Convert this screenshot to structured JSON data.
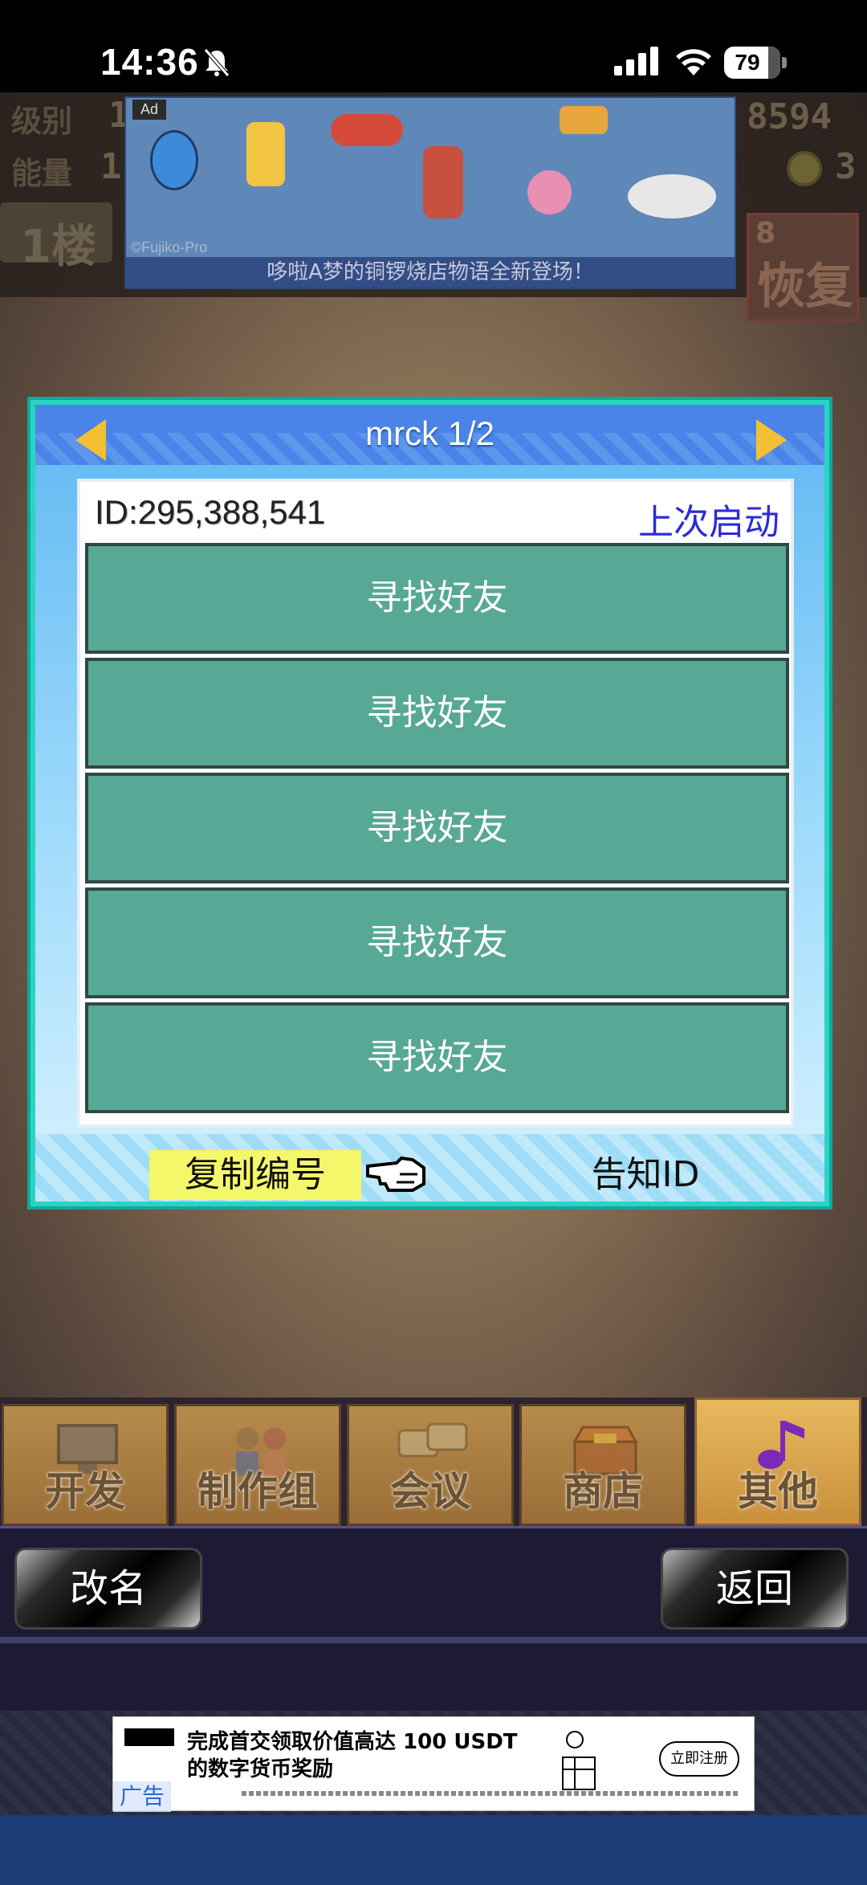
{
  "status_bar": {
    "time": "14:36",
    "battery": "79"
  },
  "hud": {
    "level_label": "级别",
    "level_value": "1",
    "energy_label": "能量",
    "energy_value": "1",
    "floor": "1楼",
    "money": "8594",
    "coins": "3",
    "recover_count": "8",
    "recover_label": "恢复"
  },
  "ad_top": {
    "badge": "Ad",
    "copyright": "©Fujiko-Pro",
    "caption": "哆啦A梦的铜锣烧店物语全新登场！"
  },
  "panel": {
    "title": "mrck 1/2",
    "id_text": "ID:295,388,541",
    "last_launch": "上次启动",
    "slots": [
      "寻找好友",
      "寻找好友",
      "寻找好友",
      "寻找好友",
      "寻找好友"
    ],
    "copy_button": "复制编号",
    "notify_button": "告知ID"
  },
  "tabs": [
    {
      "label": "开发",
      "icon": "monitor-icon",
      "active": false
    },
    {
      "label": "制作组",
      "icon": "people-icon",
      "active": false
    },
    {
      "label": "会议",
      "icon": "chat-bubbles-icon",
      "active": false
    },
    {
      "label": "商店",
      "icon": "chest-icon",
      "active": false
    },
    {
      "label": "其他",
      "icon": "music-note-icon",
      "active": true
    }
  ],
  "actions": {
    "rename": "改名",
    "back": "返回"
  },
  "ad_bottom": {
    "line1": "完成首交领取价值高达 100 USDT",
    "line2": "的数字货币奖励",
    "cta": "立即注册",
    "label": "广告"
  },
  "colors": {
    "panel_header": "#4a84e8",
    "slot": "#57a895",
    "last_launch": "#2b2bd9",
    "copy_highlight": "#f4f76a"
  }
}
